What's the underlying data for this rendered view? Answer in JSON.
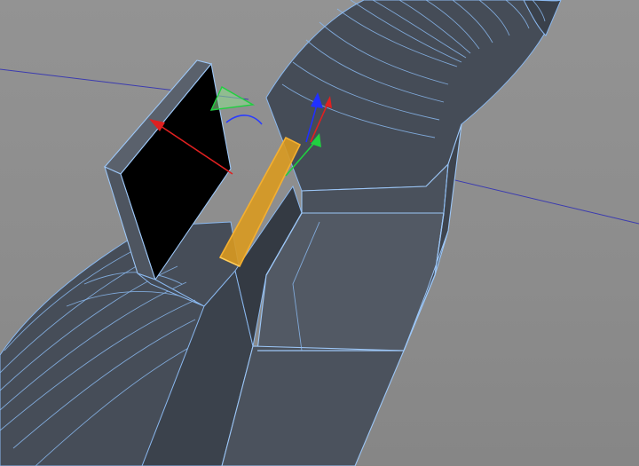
{
  "viewport": {
    "background_color": "#8f8f8f",
    "mesh_face_color": "#3f4650",
    "mesh_wire_color": "#8ab8ef",
    "selection_color": "#f0a020",
    "construction_line_color": "#3b3bb0",
    "black_face_color": "#000000"
  },
  "gizmo": {
    "x_axis_color": "#e02020",
    "y_axis_color": "#20d040",
    "z_axis_color": "#2030ff",
    "plane_handle_color": "#90e090"
  }
}
